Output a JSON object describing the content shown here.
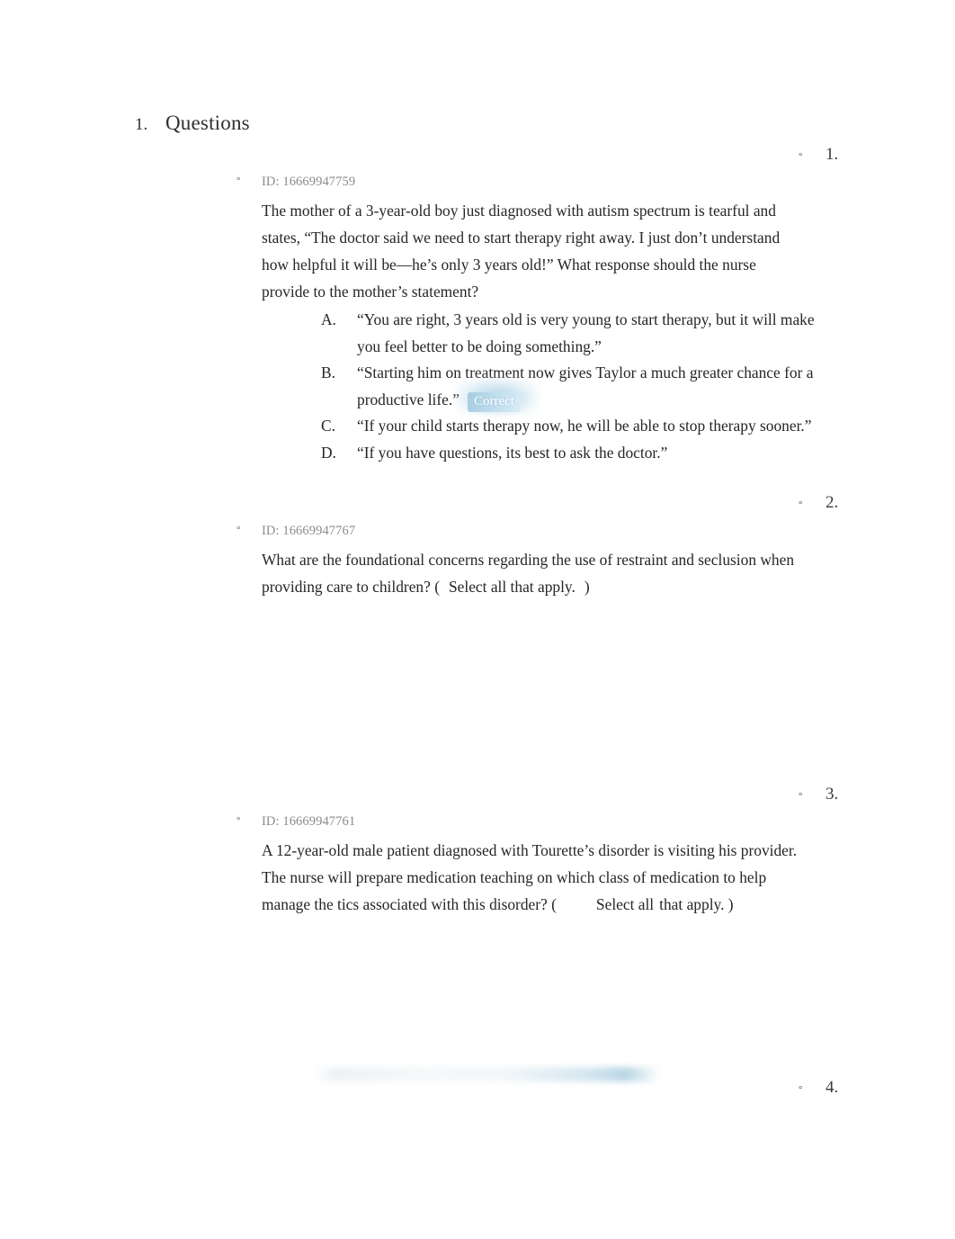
{
  "document": {
    "heading_marker": "1.",
    "heading": "Questions"
  },
  "right_markers": [
    {
      "bullet": "°",
      "number": "1."
    },
    {
      "bullet": "°",
      "number": "2."
    },
    {
      "bullet": "°",
      "number": "3."
    },
    {
      "bullet": "°",
      "number": "4."
    }
  ],
  "questions": [
    {
      "bullet": "°",
      "id_label": "ID: 16669947759",
      "stem": "The mother of a 3-year-old boy just diagnosed with autism spectrum is tearful and states, “The doctor said we need to start therapy right away. I just don’t understand how helpful it will be—he’s only 3 years old!” What response should the nurse provide to the mother’s statement?",
      "options": [
        {
          "letter": "A.",
          "text": "“You are right, 3 years old is very young to start therapy, but it will make you feel better to be doing something.”",
          "badge": ""
        },
        {
          "letter": "B.",
          "text": "“Starting him on treatment now gives Taylor a much greater chance for a productive life.”",
          "badge": "Correct"
        },
        {
          "letter": "C.",
          "text": "“If your child starts therapy now, he will be able to stop therapy sooner.”",
          "badge": ""
        },
        {
          "letter": "D.",
          "text": "“If you have questions, its best to ask the doctor.”",
          "badge": ""
        }
      ]
    },
    {
      "bullet": "°",
      "id_label": "ID: 16669947767",
      "stem_part1": "What are the foundational concerns regarding the use of restraint and seclusion when providing care to children? (",
      "stem_select": "Select all that apply.",
      "stem_part2": ")"
    },
    {
      "bullet": "°",
      "id_label": "ID: 16669947761",
      "stem_part1": "A 12-year-old male patient diagnosed with Tourette’s disorder is visiting his provider. The nurse will prepare medication teaching on which class of medication to help manage the tics associated with this disorder? (",
      "stem_select": "Select all",
      "stem_part2": "that apply.  )"
    }
  ],
  "colors": {
    "page_background": "#ffffff",
    "body_text": "#262626",
    "id_text": "#8b8b8b",
    "correct_badge_text": "#ffffff",
    "correct_badge_background": "#a6cde2"
  }
}
